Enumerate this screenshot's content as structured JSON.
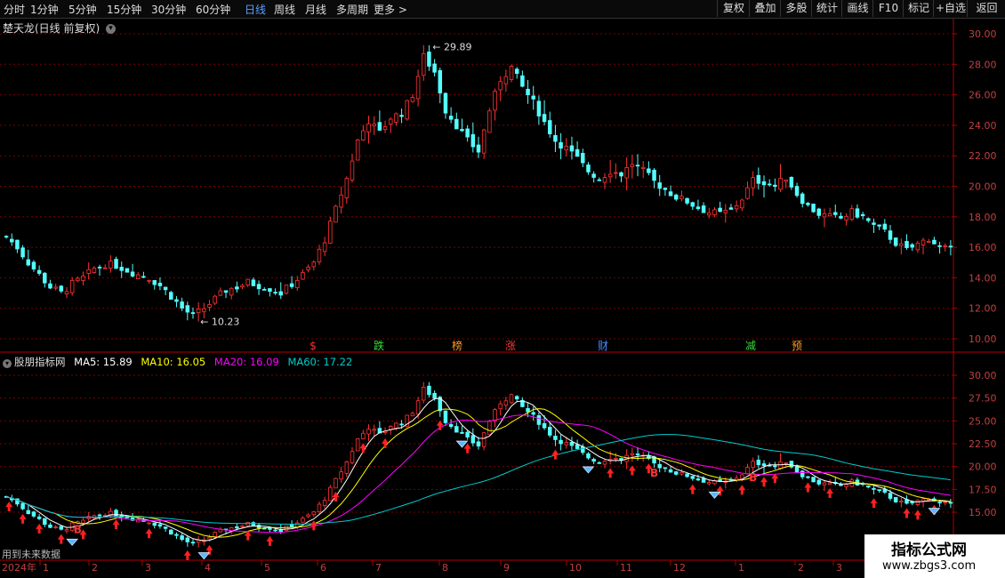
{
  "toolbar": {
    "timeframes": [
      "分时",
      "1分钟",
      "5分钟",
      "15分钟",
      "30分钟",
      "60分钟",
      "日线",
      "周线",
      "月线",
      "多周期",
      "更多 >"
    ],
    "active_timeframe": "日线",
    "right_buttons": [
      "复权",
      "叠加",
      "多股",
      "统计",
      "画线",
      "F10",
      "标记",
      "+自选",
      "返回"
    ]
  },
  "main_chart": {
    "title": "楚天龙(日线 前复权)",
    "y_ticks": [
      "30.00",
      "28.00",
      "26.00",
      "24.00",
      "22.00",
      "20.00",
      "18.00",
      "16.00",
      "14.00",
      "12.00",
      "10.00"
    ],
    "high_label": "29.89",
    "low_label": "10.23",
    "event_markers": [
      {
        "text": "$",
        "color": "#ff3333"
      },
      {
        "text": "跌",
        "color": "#33dd33"
      },
      {
        "text": "榜",
        "color": "#ff9922"
      },
      {
        "text": "涨",
        "color": "#ff3333"
      },
      {
        "text": "财",
        "color": "#4a8cff"
      },
      {
        "text": "减",
        "color": "#33dd33"
      },
      {
        "text": "预",
        "color": "#ff9922"
      }
    ]
  },
  "indicator": {
    "name": "股朋指标网",
    "ma5": "MA5: 15.89",
    "ma10": "MA10: 16.05",
    "ma20": "MA20: 16.09",
    "ma60": "MA60: 17.22",
    "y_ticks": [
      "30.00",
      "27.50",
      "25.00",
      "22.50",
      "20.00",
      "17.50",
      "15.00"
    ],
    "footer_text": "用到未来数据",
    "b_label": "B"
  },
  "x_axis": {
    "labels": [
      "2024年",
      "1",
      "2",
      "3",
      "4",
      "5",
      "6",
      "7",
      "8",
      "9",
      "10",
      "11",
      "12",
      "1",
      "2",
      "3"
    ]
  },
  "watermark": {
    "line1": "指标公式网",
    "line2": "www.zbgs3.com"
  },
  "colors": {
    "up": "#ff3333",
    "down": "#54ffff",
    "grid": "#7a0000",
    "ma5": "#ffffff",
    "ma10": "#ffff00",
    "ma20": "#ff00ff",
    "ma60": "#00cccc"
  },
  "chart_data": {
    "type": "candlestick",
    "title": "楚天龙(日线 前复权)",
    "ylim": [
      10,
      30.5
    ],
    "y_ticks": [
      10,
      12,
      14,
      16,
      18,
      20,
      22,
      24,
      26,
      28,
      30
    ],
    "x_categories": [
      "2024-01",
      "2024-02",
      "2024-03",
      "2024-04",
      "2024-05",
      "2024-06",
      "2024-07",
      "2024-08",
      "2024-09",
      "2024-10",
      "2024-11",
      "2024-12",
      "2025-01",
      "2025-02",
      "2025-03"
    ],
    "close_path": [
      [
        0,
        16.7
      ],
      [
        2,
        16.0
      ],
      [
        4,
        15.0
      ],
      [
        6,
        14.2
      ],
      [
        8,
        13.4
      ],
      [
        10,
        13.0
      ],
      [
        12,
        13.6
      ],
      [
        14,
        14.0
      ],
      [
        16,
        14.6
      ],
      [
        18,
        14.9
      ],
      [
        20,
        14.8
      ],
      [
        22,
        14.5
      ],
      [
        24,
        14.2
      ],
      [
        26,
        14.0
      ],
      [
        28,
        13.5
      ],
      [
        30,
        12.8
      ],
      [
        32,
        12.0
      ],
      [
        34,
        11.5
      ],
      [
        36,
        12.0
      ],
      [
        38,
        12.6
      ],
      [
        40,
        13.2
      ],
      [
        42,
        13.4
      ],
      [
        44,
        13.7
      ],
      [
        46,
        13.5
      ],
      [
        48,
        13.3
      ],
      [
        50,
        13.0
      ],
      [
        52,
        13.6
      ],
      [
        54,
        14.2
      ],
      [
        56,
        15.0
      ],
      [
        58,
        16.5
      ],
      [
        60,
        18.5
      ],
      [
        62,
        20.5
      ],
      [
        64,
        23.0
      ],
      [
        66,
        24.3
      ],
      [
        68,
        23.5
      ],
      [
        70,
        24.5
      ],
      [
        72,
        24.8
      ],
      [
        74,
        26.0
      ],
      [
        76,
        28.5
      ],
      [
        78,
        27.5
      ],
      [
        80,
        25.0
      ],
      [
        82,
        24.0
      ],
      [
        84,
        23.0
      ],
      [
        86,
        22.3
      ],
      [
        88,
        25.0
      ],
      [
        90,
        27.0
      ],
      [
        92,
        27.8
      ],
      [
        94,
        26.5
      ],
      [
        96,
        25.5
      ],
      [
        98,
        24.2
      ],
      [
        100,
        23.0
      ],
      [
        102,
        22.5
      ],
      [
        104,
        21.8
      ],
      [
        106,
        21.0
      ],
      [
        108,
        20.5
      ],
      [
        110,
        21.0
      ],
      [
        112,
        20.8
      ],
      [
        114,
        21.5
      ],
      [
        116,
        21.0
      ],
      [
        118,
        20.3
      ],
      [
        120,
        19.8
      ],
      [
        122,
        19.3
      ],
      [
        124,
        19.0
      ],
      [
        126,
        18.6
      ],
      [
        128,
        18.3
      ],
      [
        130,
        18.2
      ],
      [
        132,
        18.4
      ],
      [
        134,
        19.2
      ],
      [
        136,
        20.4
      ],
      [
        138,
        20.3
      ],
      [
        140,
        20.0
      ],
      [
        142,
        20.6
      ],
      [
        144,
        19.5
      ],
      [
        146,
        18.7
      ],
      [
        148,
        18.2
      ],
      [
        150,
        18.0
      ],
      [
        152,
        17.9
      ],
      [
        154,
        18.3
      ],
      [
        156,
        18.0
      ],
      [
        158,
        17.4
      ],
      [
        160,
        17.0
      ],
      [
        162,
        16.3
      ],
      [
        164,
        15.8
      ],
      [
        166,
        16.2
      ],
      [
        168,
        16.6
      ],
      [
        170,
        16.0
      ],
      [
        172,
        15.8
      ]
    ],
    "series": [
      {
        "name": "MA5",
        "last": 15.89
      },
      {
        "name": "MA10",
        "last": 16.05
      },
      {
        "name": "MA20",
        "last": 16.09
      },
      {
        "name": "MA60",
        "last": 17.22
      }
    ]
  }
}
